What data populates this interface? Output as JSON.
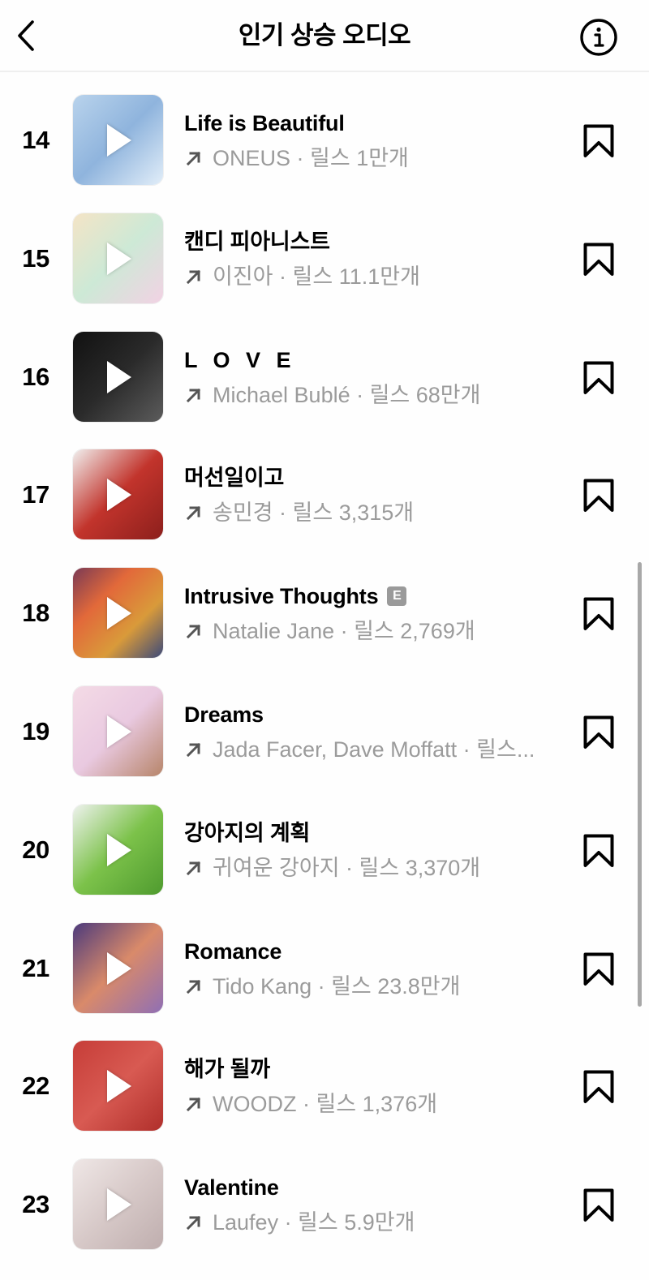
{
  "header": {
    "title": "인기 상승 오디오",
    "back_icon": "chevron-left-icon",
    "info_icon": "info-circle-icon"
  },
  "separator": "·",
  "reels_label": "릴스",
  "trend_icon": "arrow-up-right-icon",
  "save_icon": "bookmark-icon",
  "items": [
    {
      "rank": "14",
      "title": "Life is Beautiful",
      "explicit": false,
      "artist": "ONEUS",
      "meta": "ONEUS · 릴스 1만개",
      "reels_count": "1만개",
      "art_colors": [
        "#b9d3ec",
        "#8fb4dd",
        "#e2eef9"
      ]
    },
    {
      "rank": "15",
      "title": "캔디 피아니스트",
      "explicit": false,
      "artist": "이진아",
      "meta": "이진아 · 릴스 11.1만개",
      "reels_count": "11.1만개",
      "art_colors": [
        "#f4e4c6",
        "#cde9d6",
        "#f2d2e4"
      ]
    },
    {
      "rank": "16",
      "title": "L O V E",
      "explicit": false,
      "artist": "Michael Bublé",
      "meta": "Michael Bublé · 릴스 68만개",
      "reels_count": "68만개",
      "art_colors": [
        "#111111",
        "#2a2a2a",
        "#5c5c5c"
      ]
    },
    {
      "rank": "17",
      "title": "머선일이고",
      "explicit": false,
      "artist": "송민경",
      "meta": "송민경 · 릴스 3,315개",
      "reels_count": "3,315개",
      "art_colors": [
        "#f1efee",
        "#c2342c",
        "#8c1f1c"
      ]
    },
    {
      "rank": "18",
      "title": "Intrusive Thoughts",
      "explicit": true,
      "explicit_label": "E",
      "artist": "Natalie Jane",
      "meta": "Natalie Jane · 릴스 2,769개",
      "reels_count": "2,769개",
      "art_colors": [
        "#7a3a55",
        "#e2693a",
        "#d99a3a",
        "#3c4a7a"
      ]
    },
    {
      "rank": "19",
      "title": "Dreams",
      "explicit": false,
      "artist": "Jada Facer, Dave Moffatt",
      "meta": "Jada Facer, Dave Moffatt · 릴스...",
      "reels_count": "",
      "art_colors": [
        "#f4dbe6",
        "#e9c9e0",
        "#b7856a"
      ]
    },
    {
      "rank": "20",
      "title": "강아지의 계획",
      "explicit": false,
      "artist": "귀여운 강아지",
      "meta": "귀여운 강아지 · 릴스 3,370개",
      "reels_count": "3,370개",
      "art_colors": [
        "#eef2ee",
        "#7cc24a",
        "#4f9b2f"
      ]
    },
    {
      "rank": "21",
      "title": "Romance",
      "explicit": false,
      "artist": "Tido Kang",
      "meta": "Tido Kang · 릴스 23.8만개",
      "reels_count": "23.8만개",
      "art_colors": [
        "#4c3a7c",
        "#d98a6a",
        "#8f6fb5"
      ]
    },
    {
      "rank": "22",
      "title": "해가 될까",
      "explicit": false,
      "artist": "WOODZ",
      "meta": "WOODZ · 릴스 1,376개",
      "reels_count": "1,376개",
      "art_colors": [
        "#c63d38",
        "#d85a52",
        "#b02f2b"
      ]
    },
    {
      "rank": "23",
      "title": "Valentine",
      "explicit": false,
      "artist": "Laufey",
      "meta": "Laufey · 릴스 5.9만개",
      "reels_count": "5.9만개",
      "art_colors": [
        "#efe7e6",
        "#d7c9c8",
        "#bfaeae"
      ]
    }
  ]
}
